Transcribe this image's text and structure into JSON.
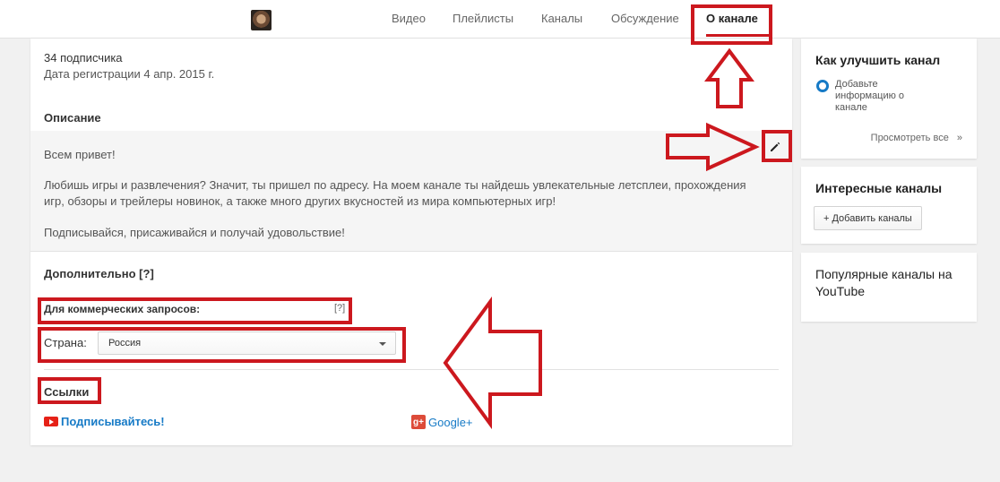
{
  "nav": {
    "tabs": [
      "Видео",
      "Плейлисты",
      "Каналы",
      "Обсуждение",
      "О канале"
    ]
  },
  "about": {
    "subscribers": "34 подписчика",
    "registered": "Дата регистрации 4 апр. 2015 г.",
    "description_title": "Описание",
    "description_lines": [
      "Всем привет!",
      "Любишь игры и развлечения? Значит, ты пришел по адресу. На моем канале ты найдешь увлекательные летсплеи, прохождения",
      "игр, обзоры и трейлеры новинок, а также много других вкусностей из мира компьютерных игр!",
      "Подписывайся, присаживайся и получай удовольствие!"
    ],
    "additional_title": "Дополнительно [?]",
    "business_label": "Для коммерческих запросов:",
    "business_help": "[?]",
    "country_label": "Страна:",
    "country_value": "Россия",
    "links_title": "Ссылки",
    "link_subscribe": "Подписывайтесь!",
    "link_gplus": "Google+"
  },
  "sidebar": {
    "improve_title": "Как улучшить канал",
    "improve_tip": "Добавьте информацию о канале",
    "view_all": "Просмотреть все",
    "view_all_chevron": "»",
    "interesting_title": "Интересные каналы",
    "add_channels": "+ Добавить каналы",
    "popular_title": "Популярные каналы на YouTube"
  },
  "colors": {
    "annotation_red": "#cc181e",
    "link_blue": "#167ac6",
    "youtube_red": "#e62117",
    "gplus_red": "#dd4b39"
  }
}
